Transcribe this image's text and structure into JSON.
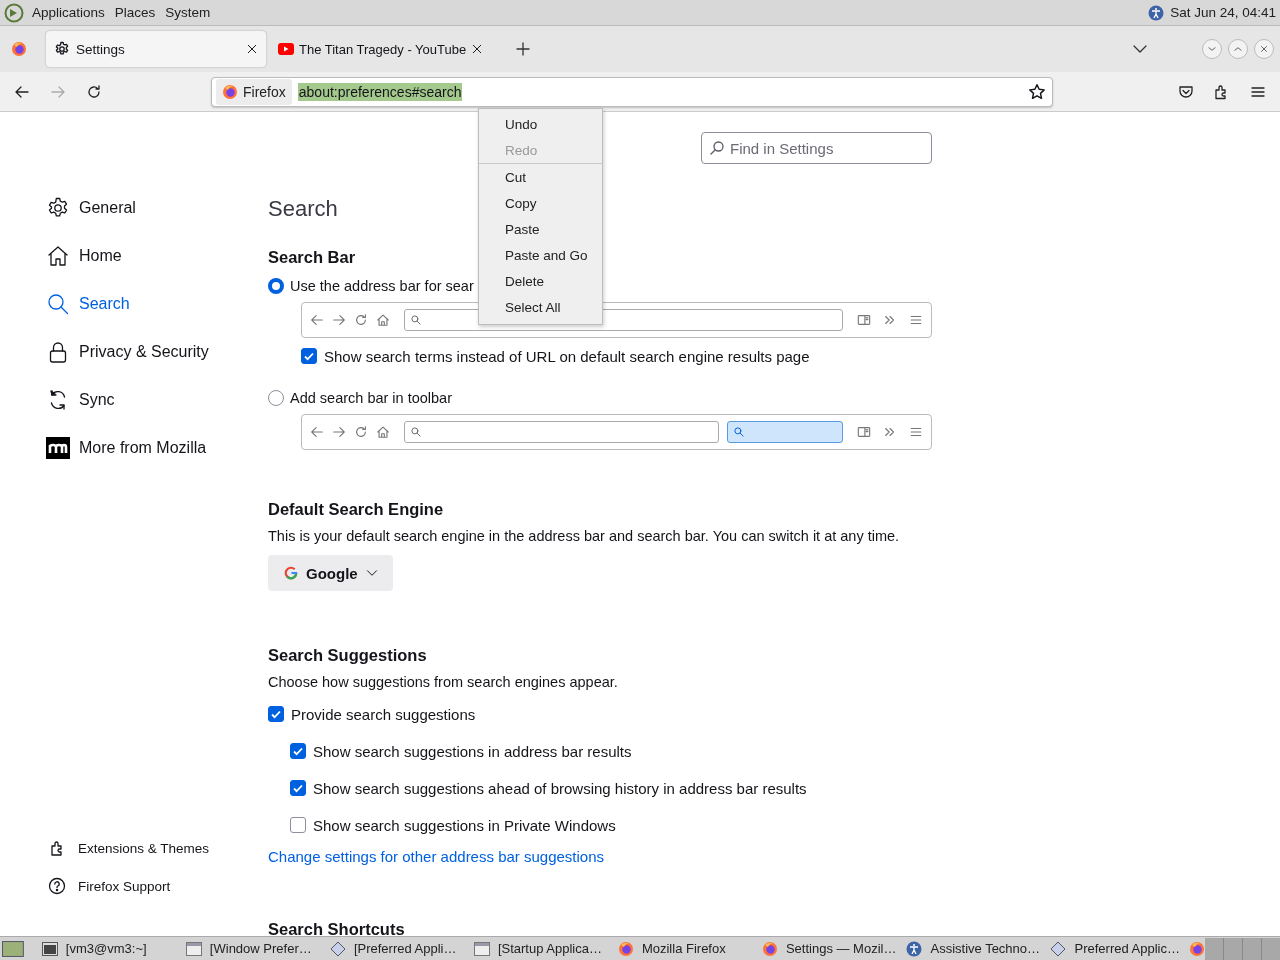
{
  "top_panel": {
    "menus": [
      "Applications",
      "Places",
      "System"
    ],
    "clock": "Sat Jun 24, 04:41"
  },
  "tabs": [
    {
      "title": "Settings",
      "kind": "settings",
      "selected": true
    },
    {
      "title": "The Titan Tragedy - YouTube",
      "kind": "video",
      "selected": false
    }
  ],
  "nav_buttons": [
    {
      "kind": "back",
      "disabled": false
    },
    {
      "kind": "forward",
      "disabled": true
    },
    {
      "kind": "reload",
      "disabled": false
    }
  ],
  "address_bar": {
    "identity": "Firefox",
    "url": "about:preferences#search",
    "url_selected": true
  },
  "context_menu": {
    "items": [
      {
        "kind": "item",
        "label": "Undo",
        "disabled": false
      },
      {
        "kind": "item",
        "label": "Redo",
        "disabled": true
      },
      {
        "kind": "separator"
      },
      {
        "kind": "item",
        "label": "Cut",
        "disabled": false
      },
      {
        "kind": "item",
        "label": "Copy",
        "disabled": false
      },
      {
        "kind": "item",
        "label": "Paste",
        "disabled": false
      },
      {
        "kind": "item",
        "label": "Paste and Go",
        "disabled": false
      },
      {
        "kind": "item",
        "label": "Delete",
        "disabled": false
      },
      {
        "kind": "item",
        "label": "Select All",
        "disabled": false
      }
    ]
  },
  "sidebar": {
    "items": [
      {
        "label": "General",
        "selected": false
      },
      {
        "label": "Home",
        "selected": false
      },
      {
        "label": "Search",
        "selected": true
      },
      {
        "label": "Privacy & Security",
        "selected": false
      },
      {
        "label": "Sync",
        "selected": false
      },
      {
        "label": "More from Mozilla",
        "selected": false
      }
    ],
    "footer": [
      {
        "label": "Extensions & Themes"
      },
      {
        "label": "Firefox Support"
      }
    ]
  },
  "search_field": {
    "placeholder": "Find in Settings"
  },
  "page_title": "Search",
  "search_bar": {
    "heading": "Search Bar",
    "options": [
      {
        "label": "Use the address bar for sear",
        "selected": true,
        "kind": "combined",
        "sub_option": {
          "label": "Show search terms instead of URL on default search engine results page",
          "checked": true
        }
      },
      {
        "label": "Add search bar in toolbar",
        "selected": false,
        "kind": "separate"
      }
    ]
  },
  "default_engine": {
    "heading": "Default Search Engine",
    "description": "This is your default search engine in the address bar and search bar. You can switch it at any time.",
    "engine": "Google"
  },
  "suggestions": {
    "heading": "Search Suggestions",
    "description": "Choose how suggestions from search engines appear.",
    "options": [
      {
        "label": "Provide search suggestions",
        "checked": true,
        "children": [
          {
            "label": "Show search suggestions in address bar results",
            "checked": true
          },
          {
            "label": "Show search suggestions ahead of browsing history in address bar results",
            "checked": true
          },
          {
            "label": "Show search suggestions in Private Windows",
            "checked": false
          }
        ]
      }
    ],
    "link": "Change settings for other address bar suggestions"
  },
  "next_heading": "Search Shortcuts",
  "taskbar": {
    "tasks": [
      {
        "label": "[vm3@vm3:~]",
        "kind": "terminal"
      },
      {
        "label": "[Window Prefer…",
        "kind": "window"
      },
      {
        "label": "[Preferred Appli…",
        "kind": "diamond"
      },
      {
        "label": "[Startup Applica…",
        "kind": "window"
      },
      {
        "label": "Mozilla Firefox",
        "kind": "firefox"
      },
      {
        "label": "Settings — Mozil…",
        "kind": "firefox"
      },
      {
        "label": "Assistive Techno…",
        "kind": "access"
      },
      {
        "label": "Preferred Applic…",
        "kind": "diamond"
      }
    ]
  }
}
